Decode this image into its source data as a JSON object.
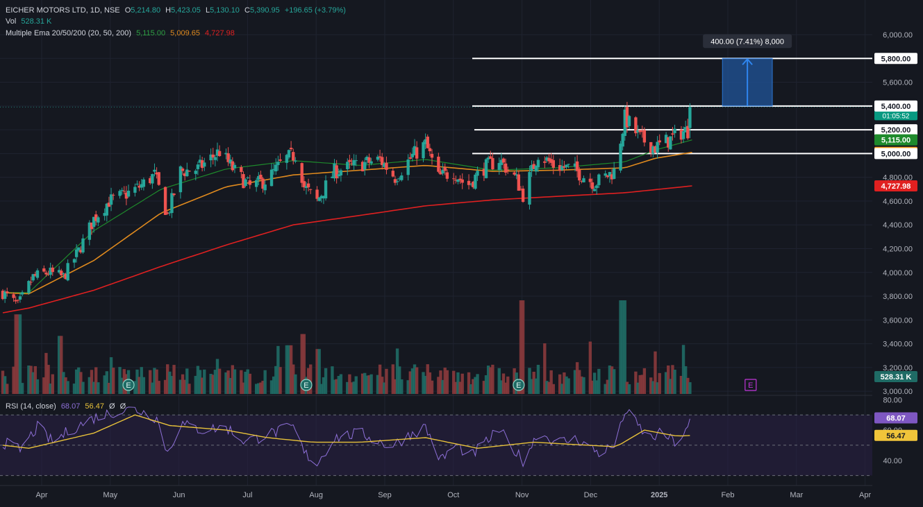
{
  "header": {
    "symbol": "EICHER MOTORS LTD, 1D, NSE",
    "o_label": "O",
    "open": "5,214.80",
    "h_label": "H",
    "high": "5,423.05",
    "l_label": "L",
    "low": "5,130.10",
    "c_label": "C",
    "close": "5,390.95",
    "change": "+196.65 (+3.79%)",
    "vol_label": "Vol",
    "vol_value": "528.31 K",
    "ema_label": "Multiple Ema 20/50/200 (20, 50, 200)",
    "ema20": "5,115.00",
    "ema50": "5,009.65",
    "ema200": "4,727.98"
  },
  "rsi_header": {
    "label": "RSI (14, close)",
    "rsi": "68.07",
    "ma": "56.47",
    "extra1": "Ø",
    "extra2": "Ø"
  },
  "colors": {
    "background": "#151820",
    "up": "#26a69a",
    "down": "#ef5350",
    "ema20": "#1e8a2c",
    "ema50": "#e08a1e",
    "ema200": "#e02020",
    "rsi": "#8e70d8",
    "rsi_ma": "#e8c23a",
    "measure": "#1f4e8c",
    "measure_line": "#2f86f0"
  },
  "chart_data": [
    {
      "type": "candlestick",
      "title": "EICHER MOTORS LTD, 1D, NSE",
      "x_tick_labels": [
        "Apr",
        "May",
        "Jun",
        "Jul",
        "Aug",
        "Sep",
        "Oct",
        "Nov",
        "Dec",
        "2025",
        "Feb",
        "Mar",
        "Apr"
      ],
      "x_date_range": [
        "2024-03-20",
        "2025-04-20"
      ],
      "y_tick_labels": [
        "6,000.00",
        "5,800.00",
        "5,600.00",
        "5,400.00",
        "5,200.00",
        "5,000.00",
        "4,800.00",
        "4,600.00",
        "4,400.00",
        "4,200.00",
        "4,000.00",
        "3,800.00",
        "3,600.00",
        "3,400.00",
        "3,200.00",
        "3,000.00"
      ],
      "ylim": [
        2995,
        6105
      ],
      "price_anchors": [
        [
          "2024-03-20",
          3830
        ],
        [
          "2024-03-27",
          3720
        ],
        [
          "2024-04-03",
          3960
        ],
        [
          "2024-04-10",
          4000
        ],
        [
          "2024-04-17",
          3960
        ],
        [
          "2024-04-24",
          4180
        ],
        [
          "2024-05-01",
          4450
        ],
        [
          "2024-05-08",
          4600
        ],
        [
          "2024-05-15",
          4650
        ],
        [
          "2024-05-22",
          4720
        ],
        [
          "2024-05-29",
          4820
        ],
        [
          "2024-06-04",
          4480
        ],
        [
          "2024-06-10",
          4850
        ],
        [
          "2024-06-18",
          4870
        ],
        [
          "2024-06-28",
          5020
        ],
        [
          "2024-07-05",
          4850
        ],
        [
          "2024-07-12",
          4720
        ],
        [
          "2024-07-20",
          4780
        ],
        [
          "2024-07-28",
          4950
        ],
        [
          "2024-08-03",
          5000
        ],
        [
          "2024-08-06",
          4720
        ],
        [
          "2024-08-12",
          4600
        ],
        [
          "2024-08-20",
          4850
        ],
        [
          "2024-08-30",
          4900
        ],
        [
          "2024-09-10",
          4950
        ],
        [
          "2024-09-17",
          4800
        ],
        [
          "2024-09-25",
          4980
        ],
        [
          "2024-10-01",
          5080
        ],
        [
          "2024-10-07",
          4800
        ],
        [
          "2024-10-14",
          4850
        ],
        [
          "2024-10-20",
          4720
        ],
        [
          "2024-10-28",
          4880
        ],
        [
          "2024-11-04",
          4950
        ],
        [
          "2024-11-12",
          4780
        ],
        [
          "2024-11-15",
          4650
        ],
        [
          "2024-11-22",
          5000
        ],
        [
          "2024-11-29",
          4900
        ],
        [
          "2024-12-08",
          4870
        ],
        [
          "2024-12-18",
          4750
        ],
        [
          "2024-12-27",
          4850
        ],
        [
          "2025-01-01",
          5300
        ],
        [
          "2025-01-08",
          5130
        ],
        [
          "2025-01-15",
          5050
        ],
        [
          "2025-01-22",
          5120
        ],
        [
          "2025-01-27",
          5180
        ],
        [
          "2025-01-31",
          5200
        ],
        [
          "2025-02-01",
          5390.95
        ]
      ],
      "ema_series": [
        {
          "name": "EMA 20",
          "last": 5115.0,
          "points": [
            [
              "2024-03-20",
              3830
            ],
            [
              "2024-04-01",
              3830
            ],
            [
              "2024-05-01",
              4350
            ],
            [
              "2024-06-01",
              4700
            ],
            [
              "2024-07-01",
              4870
            ],
            [
              "2024-08-01",
              4940
            ],
            [
              "2024-09-01",
              4900
            ],
            [
              "2024-10-01",
              4950
            ],
            [
              "2024-11-01",
              4860
            ],
            [
              "2024-12-01",
              4880
            ],
            [
              "2025-01-01",
              4930
            ],
            [
              "2025-01-15",
              5030
            ],
            [
              "2025-02-01",
              5115
            ]
          ]
        },
        {
          "name": "EMA 50",
          "last": 5009.65,
          "points": [
            [
              "2024-03-20",
              3830
            ],
            [
              "2024-04-01",
              3820
            ],
            [
              "2024-05-01",
              4100
            ],
            [
              "2024-06-01",
              4500
            ],
            [
              "2024-07-01",
              4720
            ],
            [
              "2024-08-01",
              4820
            ],
            [
              "2024-09-01",
              4860
            ],
            [
              "2024-10-01",
              4900
            ],
            [
              "2024-11-01",
              4850
            ],
            [
              "2024-12-01",
              4860
            ],
            [
              "2025-01-01",
              4880
            ],
            [
              "2025-01-15",
              4960
            ],
            [
              "2025-02-01",
              5009.65
            ]
          ]
        },
        {
          "name": "EMA 200",
          "last": 4727.98,
          "points": [
            [
              "2024-03-20",
              3660
            ],
            [
              "2024-04-01",
              3700
            ],
            [
              "2024-05-01",
              3850
            ],
            [
              "2024-06-01",
              4050
            ],
            [
              "2024-07-01",
              4230
            ],
            [
              "2024-08-01",
              4400
            ],
            [
              "2024-09-01",
              4480
            ],
            [
              "2024-10-01",
              4560
            ],
            [
              "2024-11-01",
              4610
            ],
            [
              "2024-12-01",
              4640
            ],
            [
              "2025-01-01",
              4670
            ],
            [
              "2025-02-01",
              4727.98
            ]
          ]
        }
      ],
      "horizontal_levels": [
        5800,
        5400,
        5200,
        5000
      ],
      "price_labels": [
        {
          "value": 5390.95,
          "text": "5,390.95",
          "sub": "01:05:52",
          "color": "#089981"
        },
        {
          "value": 5200,
          "text": "5,200.00",
          "color": "#ffffff"
        },
        {
          "value": 5115.0,
          "text": "5,115.00",
          "color": "#1e8a2c"
        },
        {
          "value": 5009.65,
          "text": "5,009.65",
          "color": "#e08a1e"
        },
        {
          "value": 5000,
          "text": "5,000.00",
          "color": "#ffffff"
        },
        {
          "value": 4727.98,
          "text": "4,727.98",
          "color": "#e02020"
        },
        {
          "value": 5800,
          "text": "5,800.00",
          "color": "#ffffff"
        },
        {
          "value": 5400,
          "text": "5,400.00",
          "color": "#ffffff"
        }
      ],
      "measure": {
        "text": "400.00 (7.41%) 8,000",
        "from": 5400,
        "to": 5800,
        "start": "2025-02-15",
        "end": "2025-03-10"
      },
      "volume": {
        "last": "528.31 K",
        "spikes": [
          [
            "2024-03-27",
            0.85
          ],
          [
            "2024-04-15",
            0.62
          ],
          [
            "2024-07-30",
            0.52
          ],
          [
            "2024-08-05",
            0.64
          ],
          [
            "2024-08-12",
            0.48
          ],
          [
            "2024-11-15",
            1.0
          ],
          [
            "2024-12-31",
            1.0
          ]
        ]
      },
      "earnings_markers": [
        {
          "date": "2024-05-17",
          "label": "E"
        },
        {
          "date": "2024-08-07",
          "label": "E"
        },
        {
          "date": "2024-11-13",
          "label": "E"
        },
        {
          "date": "2025-02-28",
          "label": "E"
        }
      ]
    },
    {
      "type": "line",
      "title": "RSI (14, close)",
      "y_tick_labels": [
        "80.00",
        "60.00",
        "40.00"
      ],
      "ylim": [
        28,
        82
      ],
      "levels": [
        70,
        50,
        30
      ],
      "series": [
        {
          "name": "RSI",
          "last": 68.07,
          "points": [
            [
              "2024-03-20",
              52
            ],
            [
              "2024-03-28",
              47
            ],
            [
              "2024-04-05",
              62
            ],
            [
              "2024-04-12",
              52
            ],
            [
              "2024-04-20",
              60
            ],
            [
              "2024-05-01",
              68
            ],
            [
              "2024-05-10",
              72
            ],
            [
              "2024-05-20",
              74
            ],
            [
              "2024-05-30",
              68
            ],
            [
              "2024-06-04",
              45
            ],
            [
              "2024-06-10",
              64
            ],
            [
              "2024-06-20",
              60
            ],
            [
              "2024-07-01",
              62
            ],
            [
              "2024-07-10",
              52
            ],
            [
              "2024-07-20",
              57
            ],
            [
              "2024-08-01",
              62
            ],
            [
              "2024-08-06",
              45
            ],
            [
              "2024-08-12",
              38
            ],
            [
              "2024-08-20",
              55
            ],
            [
              "2024-09-01",
              58
            ],
            [
              "2024-09-15",
              49
            ],
            [
              "2024-09-25",
              58
            ],
            [
              "2024-10-01",
              62
            ],
            [
              "2024-10-08",
              40
            ],
            [
              "2024-10-15",
              50
            ],
            [
              "2024-10-22",
              43
            ],
            [
              "2024-11-04",
              60
            ],
            [
              "2024-11-12",
              45
            ],
            [
              "2024-11-15",
              40
            ],
            [
              "2024-11-22",
              58
            ],
            [
              "2024-12-01",
              52
            ],
            [
              "2024-12-10",
              54
            ],
            [
              "2024-12-20",
              45
            ],
            [
              "2024-12-28",
              50
            ],
            [
              "2025-01-01",
              73
            ],
            [
              "2025-01-06",
              65
            ],
            [
              "2025-01-12",
              54
            ],
            [
              "2025-01-18",
              58
            ],
            [
              "2025-01-24",
              52
            ],
            [
              "2025-01-29",
              58
            ],
            [
              "2025-02-01",
              68.07
            ]
          ]
        },
        {
          "name": "MA",
          "last": 56.47,
          "points": [
            [
              "2024-03-20",
              50
            ],
            [
              "2024-04-01",
              48
            ],
            [
              "2024-05-01",
              58
            ],
            [
              "2024-05-20",
              70
            ],
            [
              "2024-06-05",
              63
            ],
            [
              "2024-07-01",
              60
            ],
            [
              "2024-07-20",
              55
            ],
            [
              "2024-08-10",
              52
            ],
            [
              "2024-09-01",
              52
            ],
            [
              "2024-10-01",
              55
            ],
            [
              "2024-10-25",
              48
            ],
            [
              "2024-11-20",
              52
            ],
            [
              "2024-12-15",
              50
            ],
            [
              "2024-12-28",
              49
            ],
            [
              "2025-01-10",
              60
            ],
            [
              "2025-01-25",
              56
            ],
            [
              "2025-02-01",
              56.47
            ]
          ]
        }
      ],
      "x_tick_labels": [
        "Apr",
        "May",
        "Jun",
        "Jul",
        "Aug",
        "Sep",
        "Oct",
        "Nov",
        "Dec",
        "2025",
        "Feb",
        "Mar",
        "Apr"
      ]
    }
  ]
}
